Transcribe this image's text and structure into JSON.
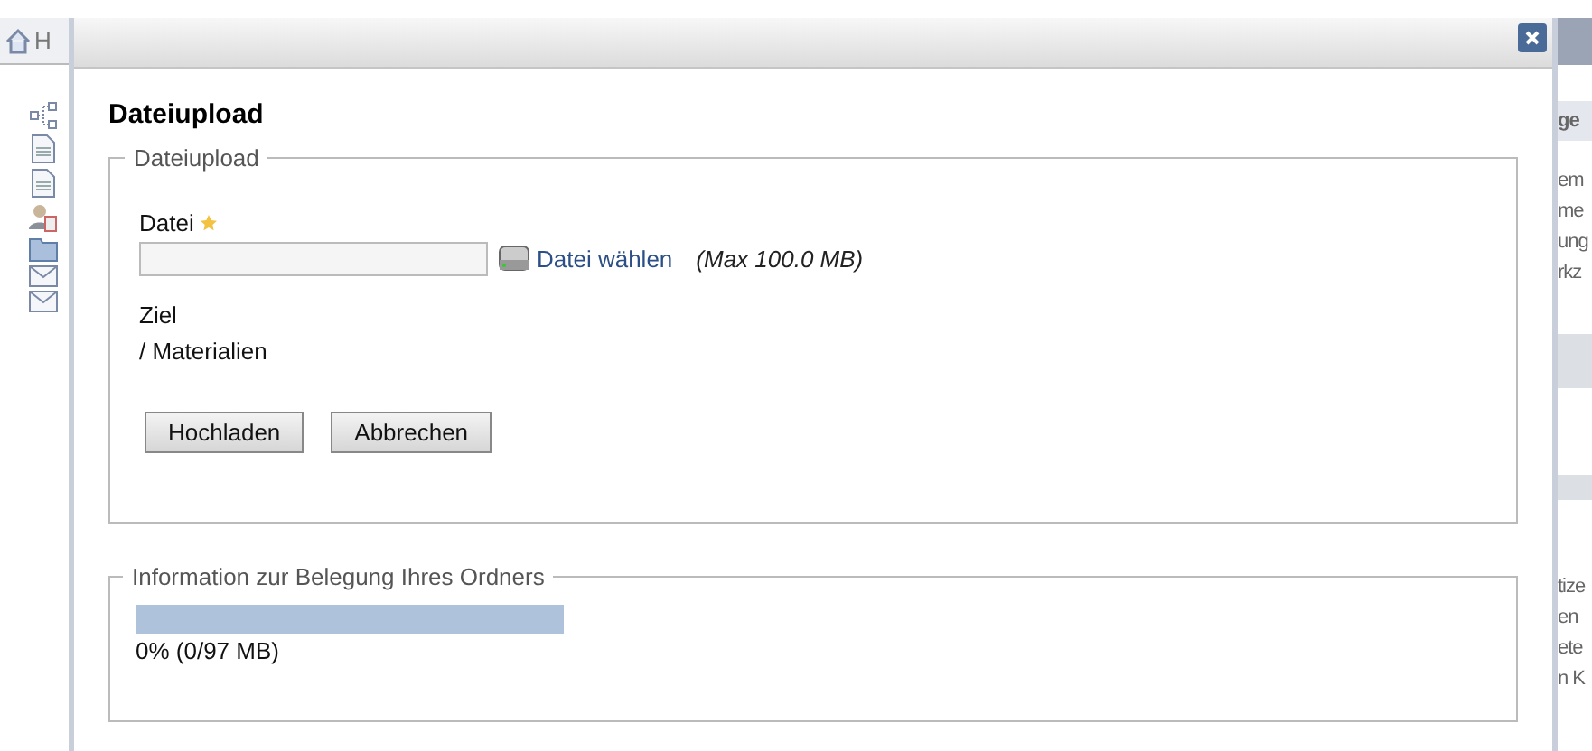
{
  "background": {
    "left_header": "H",
    "right_heading": "ge",
    "right_lines_top": [
      "em",
      "me",
      "ung",
      "rkz"
    ],
    "right_lines_bottom": [
      "tize",
      "en",
      "ete",
      "n K"
    ]
  },
  "dialog": {
    "heading": "Dateiupload",
    "upload": {
      "legend": "Dateiupload",
      "file_label": "Datei",
      "required": true,
      "choose_link": "Datei wählen",
      "max_size": "(Max 100.0 MB)",
      "target_label": "Ziel",
      "target_value": "/ Materialien",
      "buttons": [
        "Hochladen",
        "Abbrechen"
      ]
    },
    "quota": {
      "legend": "Information zur Belegung Ihres Ordners",
      "level": 0,
      "reading": "0% (0/97 MB)"
    }
  }
}
